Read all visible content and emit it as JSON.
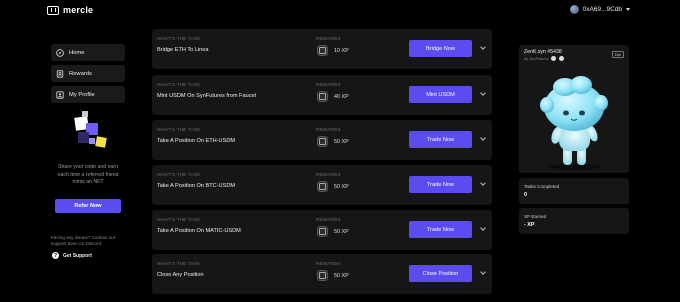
{
  "app": {
    "brand": "mercle"
  },
  "wallet": {
    "address": "0xA69...9Cdb"
  },
  "sidebar": {
    "items": [
      {
        "label": "Home",
        "icon": "compass-icon"
      },
      {
        "label": "Rewards",
        "icon": "trophy-icon"
      },
      {
        "label": "My Profile",
        "icon": "user-icon"
      }
    ],
    "promo_text": "Share your code and earn each time a referred friend mints an NFT",
    "refer_label": "Refer Now",
    "issue_text": "Facing any issues? Contact our support team on Discord.",
    "support_label": "Get Support"
  },
  "tasks": [
    {
      "kicker": "WHAT'S THE TASK",
      "name": "Bridge ETH To Linea",
      "rewards_label": "REWARDS",
      "reward": "10 XP",
      "button": "Bridge Now"
    },
    {
      "kicker": "WHAT'S THE TASK",
      "name": "Mint USDM On SynFutures from Faucet",
      "rewards_label": "REWARDS",
      "reward": "40 XP",
      "button": "Mint USDM"
    },
    {
      "kicker": "WHAT'S THE TASK",
      "name": "Take A Position On ETH-USDM",
      "rewards_label": "REWARDS",
      "reward": "50 XP",
      "button": "Trade Now"
    },
    {
      "kicker": "WHAT'S THE TASK",
      "name": "Take A Position On BTC-USDM",
      "rewards_label": "REWARDS",
      "reward": "50 XP",
      "button": "Trade Now"
    },
    {
      "kicker": "WHAT'S THE TASK",
      "name": "Take A Position On MATIC-USDM",
      "rewards_label": "REWARDS",
      "reward": "50 XP",
      "button": "Trade Now"
    },
    {
      "kicker": "WHAT'S THE TASK",
      "name": "Close Any Position",
      "rewards_label": "REWARDS",
      "reward": "50 XP",
      "button": "Close Position"
    }
  ],
  "nft": {
    "title": "ZenK.syn #5438",
    "subtitle": "by SynFutures",
    "edit_label": "Edit"
  },
  "stats": {
    "tasks_completed_label": "Tasks Completed",
    "tasks_completed_value": "0",
    "xp_label": "XP Earned",
    "xp_value": "- XP"
  },
  "colors": {
    "accent": "#5b4cf0",
    "card": "#161616",
    "background": "#000000"
  }
}
